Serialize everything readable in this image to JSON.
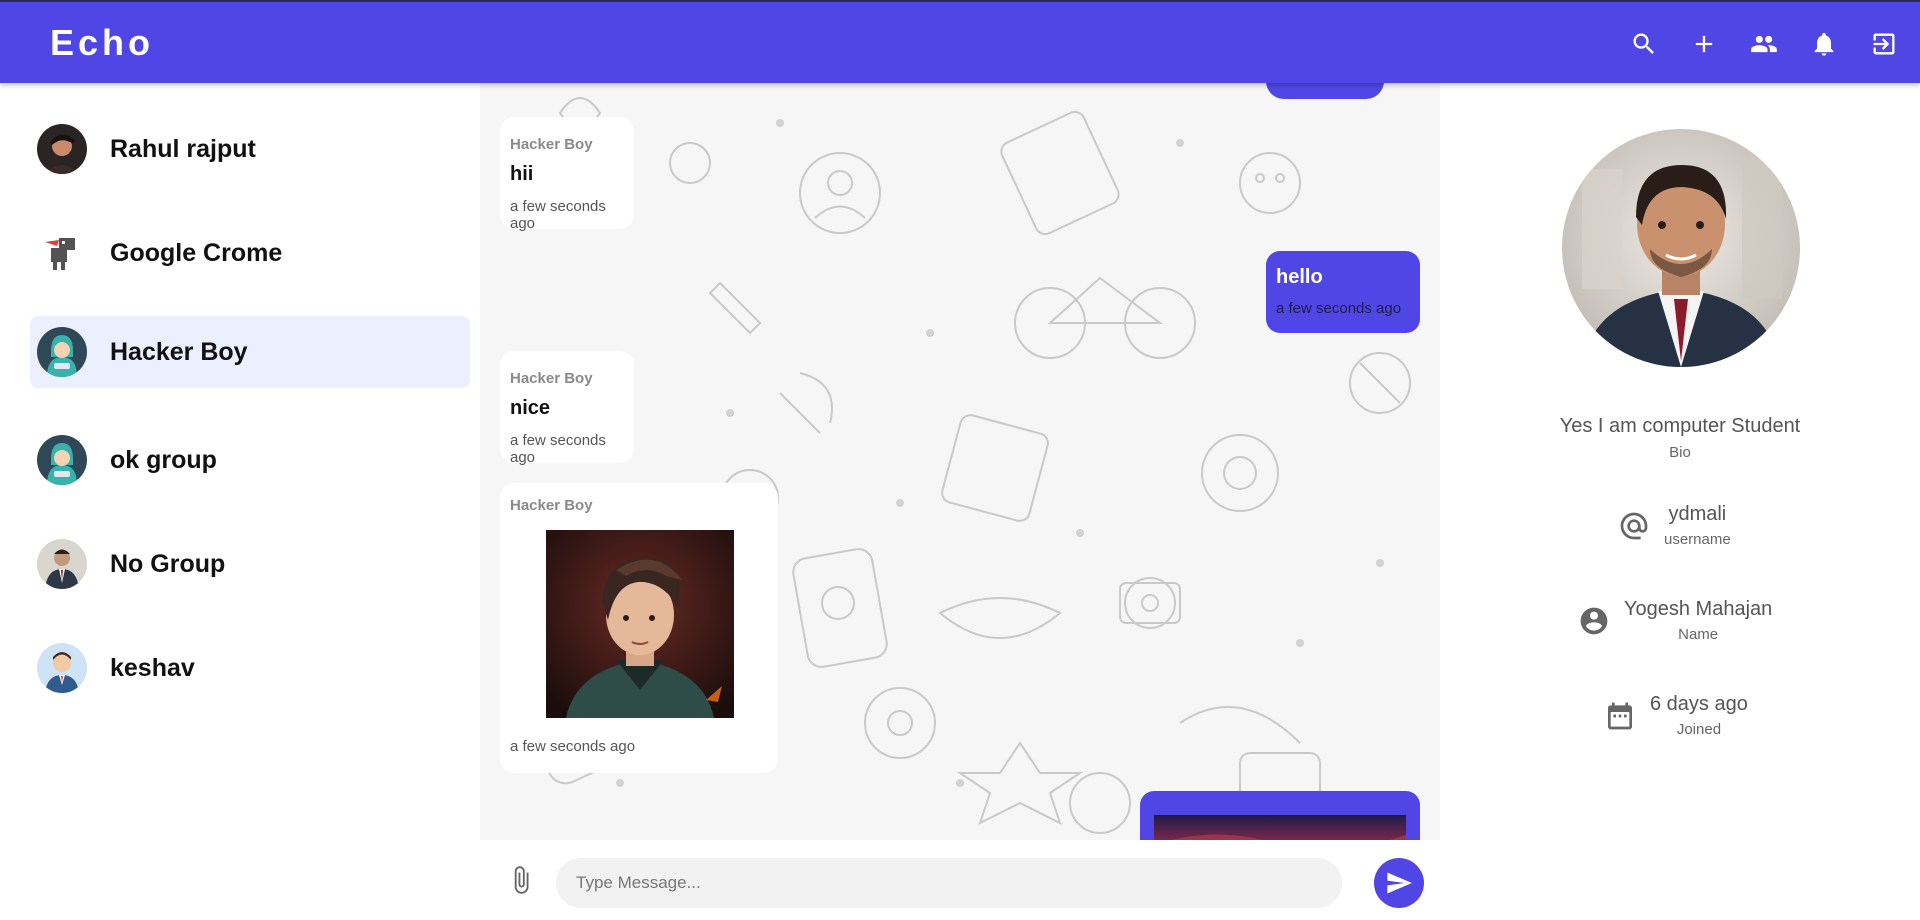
{
  "app": {
    "brand": "Echo"
  },
  "header": {
    "actions": [
      {
        "icon": "search-icon"
      },
      {
        "icon": "add-icon"
      },
      {
        "icon": "groups-icon"
      },
      {
        "icon": "notifications-icon"
      },
      {
        "icon": "logout-icon"
      }
    ]
  },
  "sidebar": {
    "contacts": [
      {
        "name": "Rahul rajput",
        "avatar": "avatar-rahul"
      },
      {
        "name": "Google Crome",
        "avatar": "avatar-dino"
      },
      {
        "name": "Hacker Boy",
        "avatar": "avatar-hacker",
        "active": true
      },
      {
        "name": "ok group",
        "avatar": "avatar-hacker"
      },
      {
        "name": "No Group",
        "avatar": "avatar-suit"
      },
      {
        "name": "keshav",
        "avatar": "avatar-cartoon"
      }
    ]
  },
  "chat": {
    "messages": [
      {
        "from": "other",
        "sender": "Hacker Boy",
        "text": "hii",
        "time": "a few seconds ago"
      },
      {
        "from": "me",
        "text": "hello",
        "time": "a few seconds ago"
      },
      {
        "from": "other",
        "sender": "Hacker Boy",
        "text": "nice",
        "time": "a few seconds ago"
      },
      {
        "from": "other",
        "sender": "Hacker Boy",
        "image": "boy-portrait-image",
        "time": "a few seconds ago"
      },
      {
        "from": "me",
        "image": "sunset-image"
      }
    ]
  },
  "composer": {
    "placeholder": "Type Message...",
    "attach_icon": "attach-icon",
    "send_icon": "send-icon"
  },
  "profile": {
    "photo": "profile-photo",
    "bio": {
      "value": "Yes I am computer Student",
      "label": "Bio"
    },
    "username": {
      "value": "ydmali",
      "label": "username",
      "icon": "at-icon"
    },
    "name": {
      "value": "Yogesh Mahajan",
      "label": "Name",
      "icon": "account-icon"
    },
    "joined": {
      "value": "6 days ago",
      "label": "Joined",
      "icon": "calendar-icon"
    }
  },
  "colors": {
    "primary": "#5046e5",
    "active_row": "#eceffd",
    "chat_bg": "#f6f6f6"
  }
}
